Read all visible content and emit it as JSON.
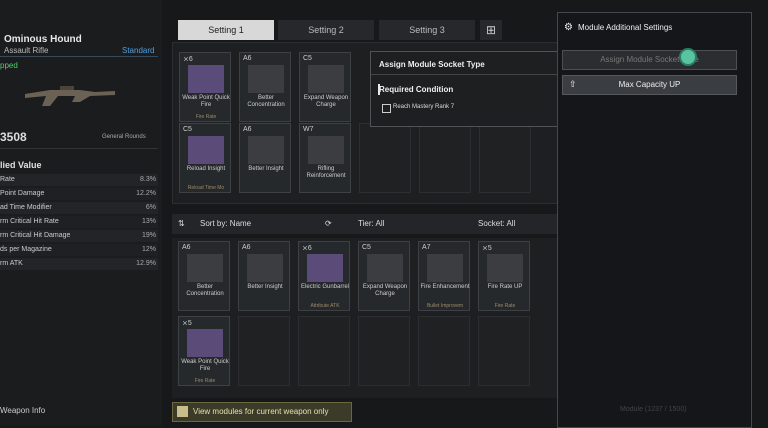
{
  "weapon": {
    "name": "Ominous Hound",
    "type": "Assault Rifle",
    "rarity": "Standard",
    "status": "pped",
    "ammo": "3508",
    "ammo_type": "General Rounds",
    "applied_title": "lied Value",
    "stats": [
      {
        "name": "Rate",
        "value": "8.3%"
      },
      {
        "name": "Point Damage",
        "value": "12.2%"
      },
      {
        "name": "ad Time Modifier",
        "value": "6%"
      },
      {
        "name": "rm Critical Hit Rate",
        "value": "13%"
      },
      {
        "name": "rm Critical Hit Damage",
        "value": "19%"
      },
      {
        "name": "ds per Magazine",
        "value": "12%"
      },
      {
        "name": "rm ATK",
        "value": "12.9%"
      }
    ],
    "info_label": "Weapon Info"
  },
  "tabs": [
    "Setting 1",
    "Setting 2",
    "Setting 3"
  ],
  "slots": [
    {
      "cap": "⨯6",
      "label": "Weak Point Quick Fire",
      "sub": "Fire Rate",
      "style": "pur"
    },
    {
      "cap": "A6",
      "label": "Better Concentration",
      "sub": "",
      "style": "gray"
    },
    {
      "cap": "C5",
      "label": "Expand Weapon Charge",
      "sub": "",
      "style": "gray"
    },
    {
      "cap": "C5",
      "label": "Reload Insight",
      "sub": "Reload Time Mo",
      "style": "pur"
    },
    {
      "cap": "A6",
      "label": "Better Insight",
      "sub": "",
      "style": "gray"
    },
    {
      "cap": "W7",
      "label": "Rifling Reinforcement",
      "sub": "",
      "style": "gray"
    }
  ],
  "sortbar": {
    "sort": "Sort by: Name",
    "tier": "Tier: All",
    "socket": "Socket: All"
  },
  "list": [
    {
      "cap": "A6",
      "label": "Better Concentration",
      "sub": "",
      "style": "gray"
    },
    {
      "cap": "A6",
      "label": "Better Insight",
      "sub": "",
      "style": "gray"
    },
    {
      "cap": "⨯6",
      "label": "Electric Gunbarrel",
      "sub": "Attribute ATK",
      "style": "pur"
    },
    {
      "cap": "C5",
      "label": "Expand Weapon Charge",
      "sub": "",
      "style": "gray"
    },
    {
      "cap": "A7",
      "label": "Fire Enhancement",
      "sub": "Bullet Improvem",
      "style": "gray"
    },
    {
      "cap": "⨯5",
      "label": "Fire Rate UP",
      "sub": "Fire Rate",
      "style": "gray"
    },
    {
      "cap": "⨯5",
      "label": "Weak Point Quick Fire",
      "sub": "Fire Rate",
      "style": "pur"
    }
  ],
  "filter_label": "View modules for current weapon only",
  "popup": {
    "title": "Assign Module Socket Type",
    "required": "Required Condition",
    "condition": "Reach Mastery Rank 7"
  },
  "right_panel": {
    "title": "Module Additional Settings",
    "btn1": "Assign Module Socket Type",
    "btn2": "Max Capacity UP"
  },
  "footer": "Module (1237 / 1500)"
}
